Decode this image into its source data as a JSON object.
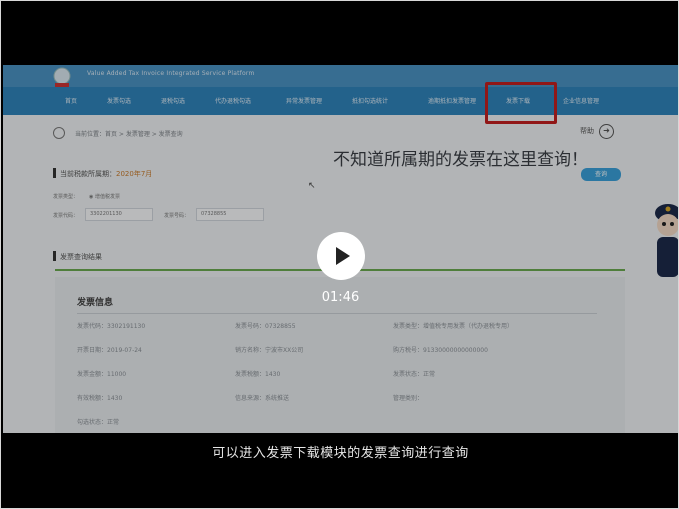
{
  "site": {
    "name": "Value Added Tax Invoice Integrated Service Platform"
  },
  "nav": {
    "items": [
      "首页",
      "发票勾选",
      "退税勾选",
      "代办退税勾选",
      "异常发票管理",
      "抵扣勾选统计",
      "逾期抵扣发票管理",
      "发票下载",
      "企业信息管理"
    ]
  },
  "breadcrumb": {
    "text": "当前位置：首页 > 发票管理 > 发票查询",
    "help": "帮助"
  },
  "overlay_text": "不知道所属期的发票在这里查询！",
  "query": {
    "title_prefix": "当前税款所属期：",
    "period": "2020年7月",
    "button": "查询",
    "type_label": "发票类型：",
    "type_value": "◉ 增值税发票",
    "code_label": "发票代码：",
    "code_value": "3302201130",
    "number_label": "发票号码：",
    "number_value": "07328855"
  },
  "result": {
    "title": "发票查询结果"
  },
  "info": {
    "heading": "发票信息",
    "rows": [
      [
        "发票代码：3302191130",
        "发票号码：07328855",
        "发票类型：增值税专用发票（代办退税专用）"
      ],
      [
        "开票日期：2019-07-24",
        "销方名称：宁波市XX公司",
        "购方税号：91330000000000000"
      ],
      [
        "发票金额：11000",
        "发票税额：1430",
        "发票状态：正常"
      ],
      [
        "有效税额：1430",
        "信息来源：系统推送",
        "管理类别："
      ],
      [
        "勾选状态：正常",
        "",
        ""
      ]
    ]
  },
  "player": {
    "time": "01:46",
    "subtitle": "可以进入发票下载模块的发票查询进行查询"
  },
  "colors": {
    "header": "#4a92c2",
    "nav": "#2f83ba",
    "highlight": "#c21f1f",
    "button": "#3a9fd8"
  }
}
